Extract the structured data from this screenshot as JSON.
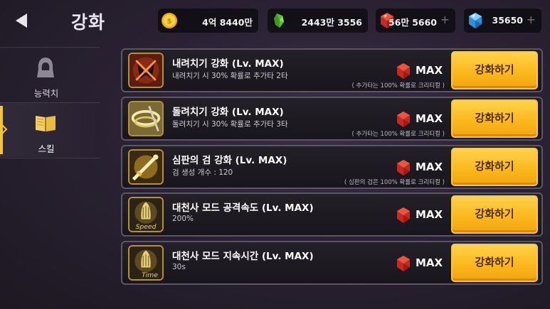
{
  "header": {
    "title": "강화",
    "back_icon": "back-arrow-icon"
  },
  "currencies": [
    {
      "icon": "gold-coin-icon",
      "value": "4억 8440만",
      "has_plus": false,
      "color": "#f7c13a"
    },
    {
      "icon": "green-crystal-icon",
      "value": "2443만 3556",
      "has_plus": false,
      "color": "#5fcb2e"
    },
    {
      "icon": "red-gem-icon",
      "value": "56만 5660",
      "has_plus": true,
      "plus": "+",
      "color": "#e0382f"
    },
    {
      "icon": "blue-diamond-icon",
      "value": "35650",
      "has_plus": true,
      "plus": "+",
      "color": "#4fb6f0"
    }
  ],
  "sidebar": {
    "items": [
      {
        "label": "능력치",
        "icon": "hooded-figure-icon",
        "active": false
      },
      {
        "label": "스킬",
        "icon": "open-book-icon",
        "active": true
      }
    ]
  },
  "colors": {
    "accent": "#f4c52e",
    "button": "#fbb91d",
    "gem": "#e0382f"
  },
  "skills": [
    {
      "title": "내려치기 강화 (Lv. MAX)",
      "desc": "내려치기 시 30% 확률로 추가타 2타",
      "note": "( 추가타는 100% 확률로 크리티컬 )",
      "status": "MAX",
      "button": "강화하기",
      "icon": "smash-strike-icon",
      "icon_caption": ""
    },
    {
      "title": "돌려치기 강화 (Lv. MAX)",
      "desc": "돌려치기 시 30% 확률로 추가타 3타",
      "note": "( 추가타는 100% 확률로 크리티컬 )",
      "status": "MAX",
      "button": "강화하기",
      "icon": "spin-slash-icon",
      "icon_caption": ""
    },
    {
      "title": "심판의 검 강화 (Lv. MAX)",
      "desc": "검 생성 개수 : 120",
      "note": "( 심판의 검은 100% 확률로 크리티컬 )",
      "status": "MAX",
      "button": "강화하기",
      "icon": "judgment-sword-icon",
      "icon_caption": ""
    },
    {
      "title": "대천사 모드 공격속도 (Lv. MAX)",
      "desc": "200%",
      "note": "",
      "status": "MAX",
      "button": "강화하기",
      "icon": "archangel-speed-icon",
      "icon_caption": "Speed"
    },
    {
      "title": "대천사 모드 지속시간 (Lv. MAX)",
      "desc": "30s",
      "note": "",
      "status": "MAX",
      "button": "강화하기",
      "icon": "archangel-time-icon",
      "icon_caption": "Time"
    }
  ]
}
